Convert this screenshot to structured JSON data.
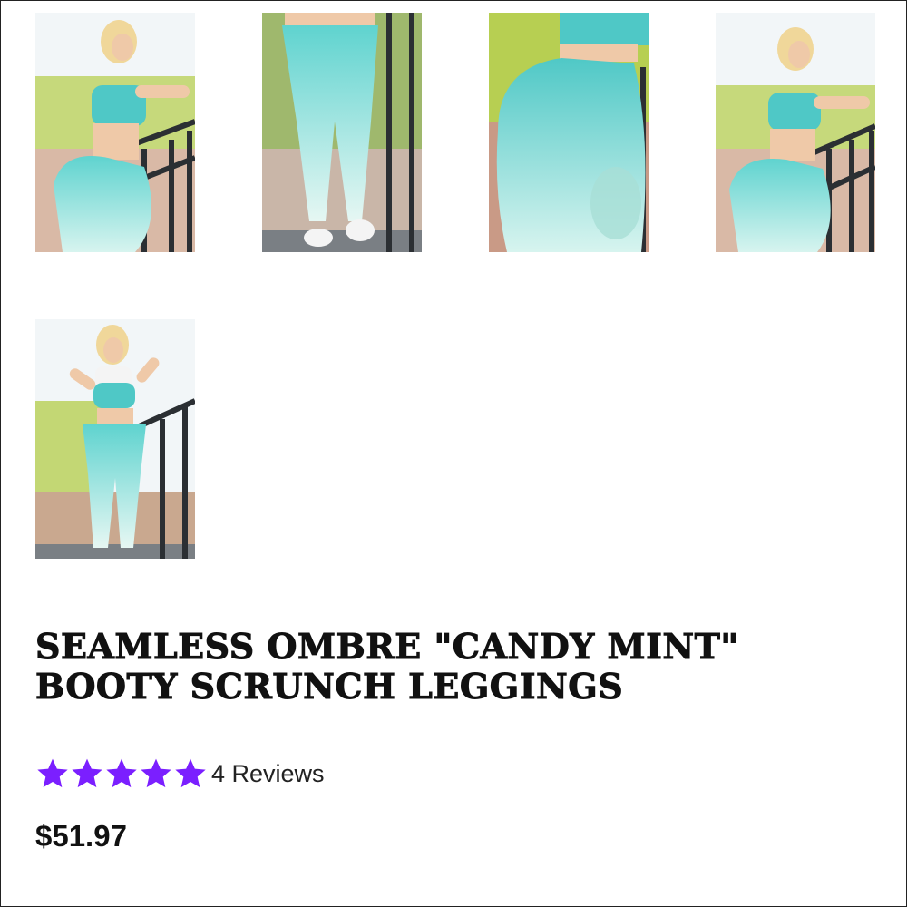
{
  "product": {
    "title_line1": "SEAMLESS OMBRE \"CANDY MINT\"",
    "title_line2": "BOOTY SCRUNCH LEGGINGS",
    "price": "$51.97",
    "rating": {
      "stars_filled": 5,
      "stars_total": 5,
      "reviews_label": "4 Reviews",
      "star_color": "#7B1FFF"
    }
  },
  "gallery": {
    "thumbnails": [
      {
        "id": "thumb-1",
        "subject": "side pose at railing"
      },
      {
        "id": "thumb-2",
        "subject": "legs front view"
      },
      {
        "id": "thumb-3",
        "subject": "back detail close-up"
      },
      {
        "id": "thumb-4",
        "subject": "side pose at railing"
      },
      {
        "id": "thumb-5",
        "subject": "full body front pose"
      }
    ],
    "accent_colors": {
      "mint": "#5fd3cf",
      "mint_light": "#c9efe9",
      "sky": "#f2f6f8",
      "foliage": "#b7cf52",
      "railing": "#2b2f33"
    }
  }
}
